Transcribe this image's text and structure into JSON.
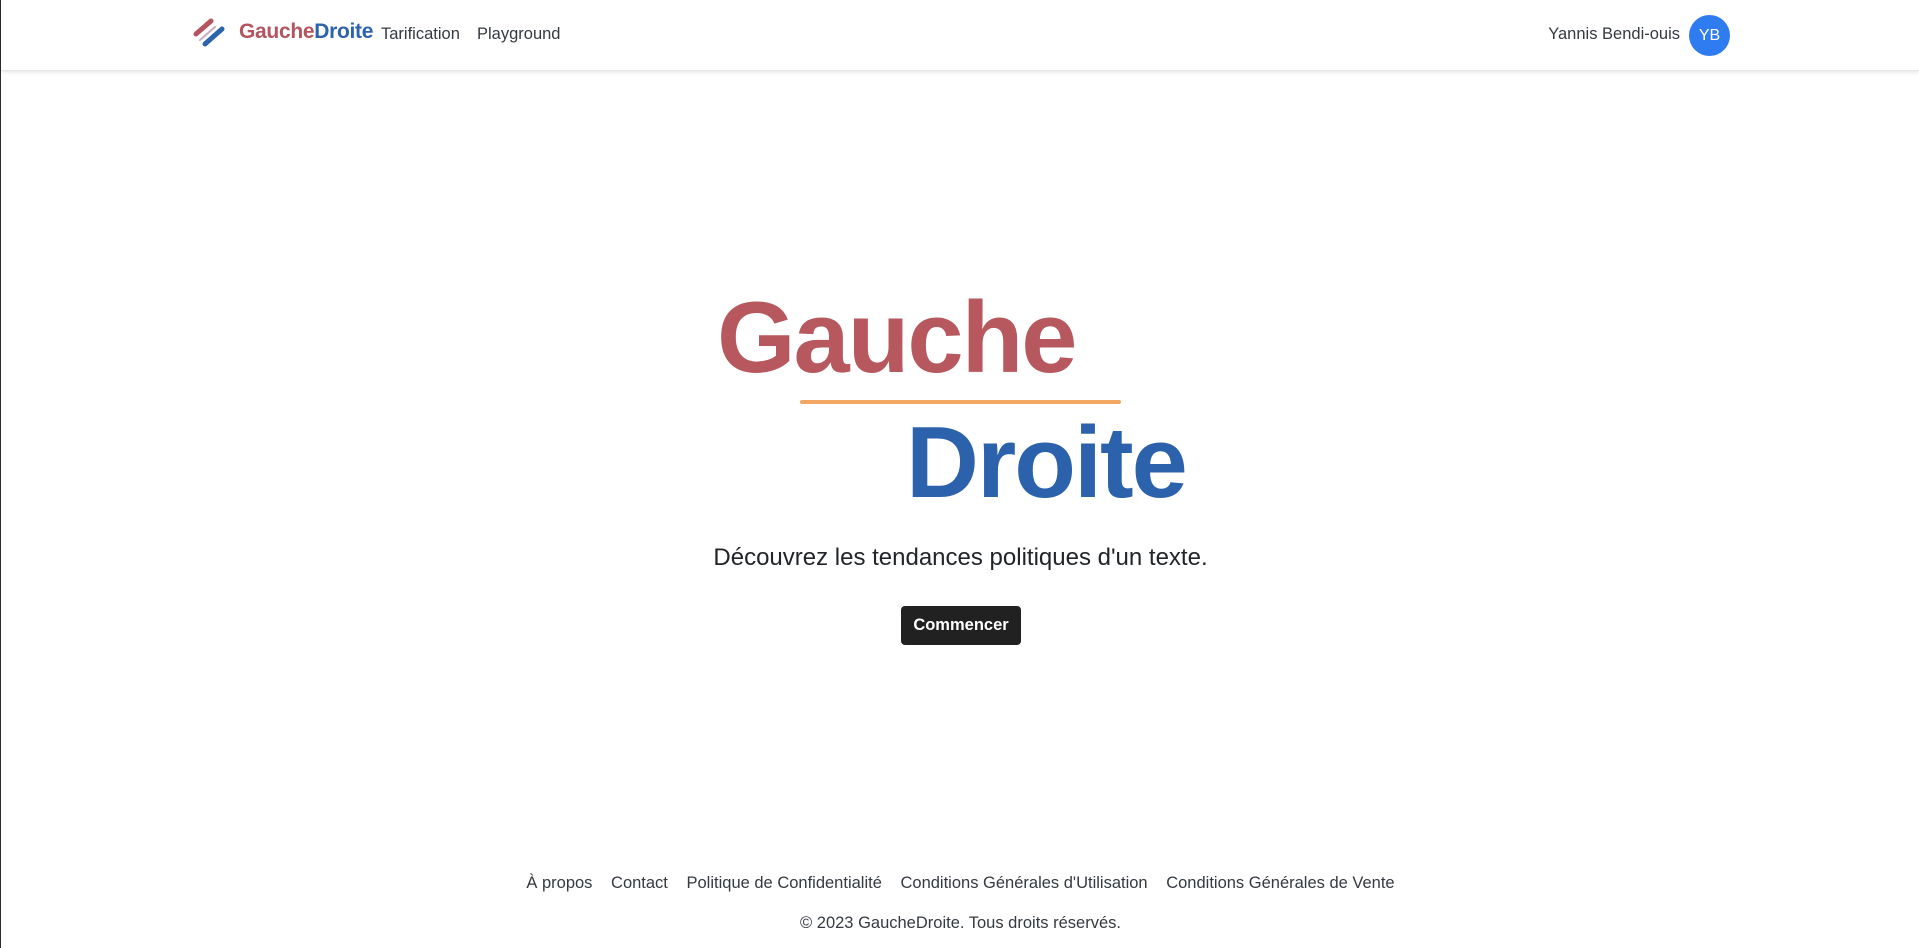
{
  "header": {
    "brand_gauche": "Gauche",
    "brand_droite": "Droite",
    "nav": [
      {
        "label": "Tarification"
      },
      {
        "label": "Playground"
      }
    ],
    "user_name": "Yannis Bendi-ouis",
    "avatar_initials": "YB",
    "logo_icon": "double-slash-logo-icon"
  },
  "hero": {
    "word_top": "Gauche",
    "word_bottom": "Droite",
    "tagline": "Découvrez les tendances politiques d'un texte.",
    "cta_label": "Commencer"
  },
  "footer": {
    "links": [
      {
        "label": "À propos"
      },
      {
        "label": "Contact"
      },
      {
        "label": "Politique de Confidentialité"
      },
      {
        "label": "Conditions Générales d'Utilisation"
      },
      {
        "label": "Conditions Générales de Vente"
      }
    ],
    "copyright": "© 2023 GaucheDroite. Tous droits réservés."
  },
  "colors": {
    "gauche_red": "#b7585f",
    "droite_blue": "#2c62ab",
    "underline_orange": "#f2a765",
    "avatar_blue": "#2f7cf0",
    "button_dark": "#212121"
  }
}
